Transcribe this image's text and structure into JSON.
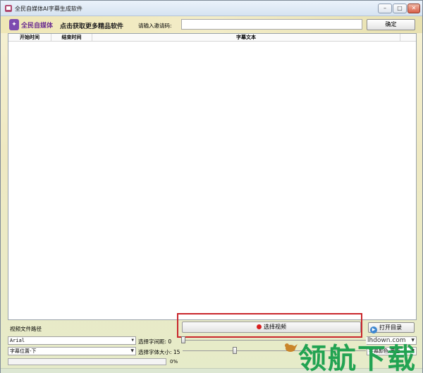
{
  "window": {
    "title": "全民自媒体AI字幕生成软件",
    "controls": {
      "minimize": "–",
      "maximize": "□",
      "close": "✕"
    }
  },
  "header": {
    "logo_text": "全民自媒体",
    "promo_link": "点击获取更多精品软件",
    "invite_label": "请输入邀请码:",
    "invite_value": "",
    "confirm_button": "确定"
  },
  "table": {
    "columns": [
      "开始时间",
      "结束时间",
      "字幕文本",
      ""
    ],
    "rows": []
  },
  "bottom": {
    "path_label": "视频文件路径",
    "select_video_button": "选择视频",
    "open_dir_button": "打开目录",
    "font_select": "Arial",
    "position_select": "字幕位置-下",
    "card_select": "卡",
    "color_select": "字幕颜色-黑色",
    "spacing_label": "选择字间距: 0",
    "size_label": "选择字体大小: 15",
    "progress_percent": 0,
    "progress_text": "0%"
  },
  "watermark": {
    "text": "领航下载",
    "url": "lhdown.com"
  },
  "colors": {
    "highlight": "#c9262b",
    "watermark": "#22a352",
    "logo": "#6a2c91",
    "record": "#d82020"
  }
}
